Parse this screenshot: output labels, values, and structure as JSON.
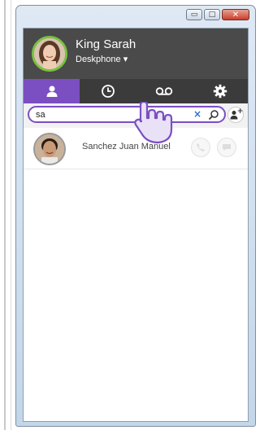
{
  "window": {
    "minimize_glyph": "▭",
    "maximize_glyph": "□",
    "close_glyph": "✕"
  },
  "user": {
    "name": "King Sarah",
    "device": "Deskphone ▾"
  },
  "tabs": [
    {
      "name": "contacts",
      "icon": "person-icon",
      "active": true
    },
    {
      "name": "history",
      "icon": "clock-icon",
      "active": false
    },
    {
      "name": "voicemail",
      "icon": "voicemail-icon",
      "active": false
    },
    {
      "name": "settings",
      "icon": "gear-icon",
      "active": false
    }
  ],
  "search": {
    "value": "sa",
    "clear_glyph": "×"
  },
  "add_contact_glyph": "+",
  "contacts": [
    {
      "name": "Sanchez Juan Manuel"
    }
  ],
  "colors": {
    "accent": "#7b4fc2",
    "header": "#4a4a4a",
    "tabbar": "#3b3b3b",
    "presence": "#7ac142"
  }
}
